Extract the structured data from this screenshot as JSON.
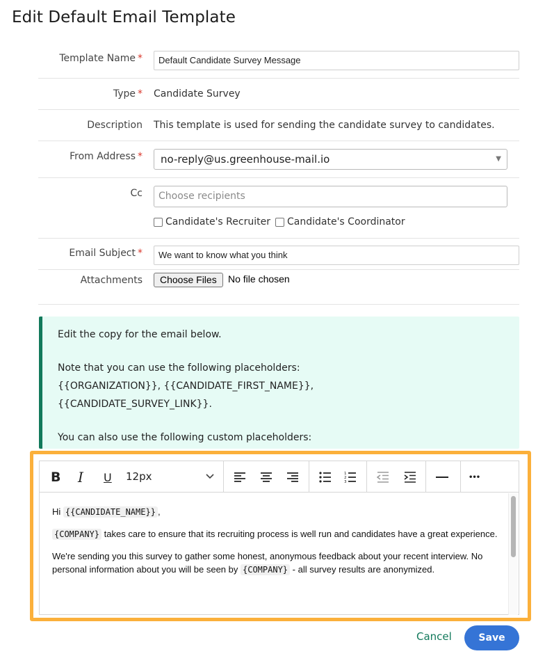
{
  "page": {
    "title": "Edit Default Email Template"
  },
  "form": {
    "template_name": {
      "label": "Template Name",
      "required": "*",
      "value": "Default Candidate Survey Message"
    },
    "type": {
      "label": "Type",
      "required": "*",
      "value": "Candidate Survey"
    },
    "description": {
      "label": "Description",
      "value": "This template is used for sending the candidate survey to candidates."
    },
    "from_address": {
      "label": "From Address",
      "required": "*",
      "value": "no-reply@us.greenhouse-mail.io"
    },
    "cc": {
      "label": "Cc",
      "placeholder": "Choose recipients",
      "recruiter_label": "Candidate's Recruiter",
      "coordinator_label": "Candidate's Coordinator"
    },
    "email_subject": {
      "label": "Email Subject",
      "required": "*",
      "value": "We want to know what you think"
    },
    "attachments": {
      "label": "Attachments",
      "button_label": "Choose Files",
      "status": "No file chosen"
    }
  },
  "callout": {
    "line1": "Edit the copy for the email below.",
    "line2": "Note that you can use the following placeholders: {{ORGANIZATION}}, {{CANDIDATE_FIRST_NAME}}, {{CANDIDATE_SURVEY_LINK}}.",
    "line3": "You can also use the following custom placeholders:"
  },
  "editor": {
    "font_size": "12px",
    "tools": {
      "bold": "B",
      "italic": "I",
      "underline": "U",
      "more": "•••"
    },
    "body": {
      "p1_prefix": "Hi ",
      "p1_placeholder": "{{CANDIDATE_NAME}}",
      "p1_suffix": ",",
      "p2_placeholder": "{COMPANY}",
      "p2_text": " takes care to ensure that its recruiting process is well run and candidates have a great experience.",
      "p3_text": "We're sending you this survey to gather some honest, anonymous feedback about your recent interview. No personal information about you will be seen by ",
      "p3_placeholder": "{COMPANY}",
      "p3_suffix": " - all survey results are anonymized."
    }
  },
  "actions": {
    "cancel_label": "Cancel",
    "save_label": "Save"
  },
  "colors": {
    "accent_green": "#12795b",
    "save_blue": "#3574d6",
    "highlight": "#fbb03b",
    "required_red": "#d9372b",
    "callout_bg": "#e6fbf5"
  }
}
